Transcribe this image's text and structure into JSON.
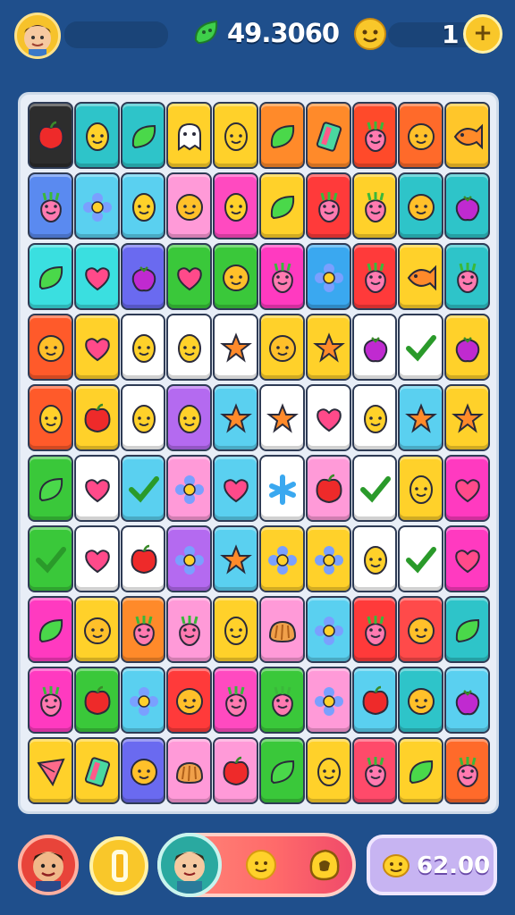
{
  "hud": {
    "score": "49.3060",
    "coins": "1",
    "plus_symbol": "+",
    "balance": "62.00"
  },
  "colors": {
    "background": "#1f4f8c",
    "board": "#e8eef7"
  },
  "icons": {
    "score_icon": "green-leaf-icon",
    "coin_icon": "gold-coin-face-icon",
    "balance_icon": "coin-face-icon"
  },
  "board": {
    "rows": [
      [
        [
          "#2d2d2d",
          "apple"
        ],
        [
          "#2ec4c9",
          "lemon"
        ],
        [
          "#2ec4c9",
          "leaf"
        ],
        [
          "#ffd12a",
          "ghost"
        ],
        [
          "#ffd12a",
          "lemon"
        ],
        [
          "#ff8a2a",
          "leaf"
        ],
        [
          "#ff8a2a",
          "candy"
        ],
        [
          "#ff4a2a",
          "radish"
        ],
        [
          "#ff6a2a",
          "face"
        ],
        [
          "#ffc62a",
          "fish"
        ]
      ],
      [
        [
          "#5a8af0",
          "radish"
        ],
        [
          "#5ad0f0",
          "flower"
        ],
        [
          "#5ad0f0",
          "lemon"
        ],
        [
          "#ff9ad8",
          "face"
        ],
        [
          "#ff4ac0",
          "lemon"
        ],
        [
          "#ffd12a",
          "leaf"
        ],
        [
          "#ff3a3a",
          "radish"
        ],
        [
          "#ffd12a",
          "radish"
        ],
        [
          "#2ec4c9",
          "face"
        ],
        [
          "#2ec4c9",
          "berry"
        ]
      ],
      [
        [
          "#3adfe0",
          "leaf"
        ],
        [
          "#3adfe0",
          "heart"
        ],
        [
          "#6a6af0",
          "berry"
        ],
        [
          "#3ac83a",
          "heart"
        ],
        [
          "#3ac83a",
          "face"
        ],
        [
          "#ff3ac0",
          "radish"
        ],
        [
          "#3aa8f0",
          "flower"
        ],
        [
          "#ff3a3a",
          "radish"
        ],
        [
          "#ffd12a",
          "fish"
        ],
        [
          "#2ec4c9",
          "radish"
        ]
      ],
      [
        [
          "#ff5a2a",
          "face"
        ],
        [
          "#ffd12a",
          "heart"
        ],
        [
          "#ffffff",
          "lemon"
        ],
        [
          "#ffffff",
          "lemon"
        ],
        [
          "#ffffff",
          "star"
        ],
        [
          "#ffd12a",
          "face"
        ],
        [
          "#ffd12a",
          "star"
        ],
        [
          "#ffffff",
          "berry"
        ],
        [
          "#ffffff",
          "check"
        ],
        [
          "#ffd12a",
          "berry"
        ]
      ],
      [
        [
          "#ff5a2a",
          "lemon"
        ],
        [
          "#ffd12a",
          "apple"
        ],
        [
          "#ffffff",
          "lemon"
        ],
        [
          "#b46af0",
          "lemon"
        ],
        [
          "#5ad0f0",
          "star"
        ],
        [
          "#ffffff",
          "star"
        ],
        [
          "#ffffff",
          "heart"
        ],
        [
          "#ffffff",
          "lemon"
        ],
        [
          "#5ad0f0",
          "star"
        ],
        [
          "#ffd12a",
          "star"
        ]
      ],
      [
        [
          "#3ac83a",
          "leaf"
        ],
        [
          "#ffffff",
          "heart"
        ],
        [
          "#5ad0f0",
          "check"
        ],
        [
          "#ff9ad8",
          "flower"
        ],
        [
          "#5ad0f0",
          "heart"
        ],
        [
          "#ffffff",
          "cross"
        ],
        [
          "#ff9ad8",
          "apple"
        ],
        [
          "#ffffff",
          "check"
        ],
        [
          "#ffd12a",
          "lemon"
        ],
        [
          "#ff3ac0",
          "heart"
        ]
      ],
      [
        [
          "#3ac83a",
          "check"
        ],
        [
          "#ffffff",
          "heart"
        ],
        [
          "#ffffff",
          "apple"
        ],
        [
          "#b46af0",
          "flower"
        ],
        [
          "#5ad0f0",
          "star"
        ],
        [
          "#ffd12a",
          "flower"
        ],
        [
          "#ffd12a",
          "flower"
        ],
        [
          "#ffffff",
          "lemon"
        ],
        [
          "#ffffff",
          "check"
        ],
        [
          "#ff3ac0",
          "heart"
        ]
      ],
      [
        [
          "#ff3ac0",
          "leaf"
        ],
        [
          "#ffd12a",
          "face"
        ],
        [
          "#ff8a2a",
          "radish"
        ],
        [
          "#ff9ad8",
          "radish"
        ],
        [
          "#ffd12a",
          "lemon"
        ],
        [
          "#ff9ad8",
          "bread"
        ],
        [
          "#5ad0f0",
          "flower"
        ],
        [
          "#ff3a3a",
          "radish"
        ],
        [
          "#ff4a4a",
          "face"
        ],
        [
          "#2ec4c9",
          "leaf"
        ]
      ],
      [
        [
          "#ff3ac0",
          "radish"
        ],
        [
          "#3ac83a",
          "apple"
        ],
        [
          "#5ad0f0",
          "flower"
        ],
        [
          "#ff3a3a",
          "face"
        ],
        [
          "#ff4ac0",
          "radish"
        ],
        [
          "#3ac83a",
          "radish"
        ],
        [
          "#ff9ad8",
          "flower"
        ],
        [
          "#5ad0f0",
          "apple"
        ],
        [
          "#2ec4c9",
          "face"
        ],
        [
          "#5ad0f0",
          "berry"
        ]
      ],
      [
        [
          "#ffd12a",
          "kite"
        ],
        [
          "#ffd12a",
          "candy"
        ],
        [
          "#6a6af0",
          "face"
        ],
        [
          "#ff9ad8",
          "bread"
        ],
        [
          "#ff9ad8",
          "apple"
        ],
        [
          "#3ac83a",
          "leaf"
        ],
        [
          "#ffd12a",
          "lemon"
        ],
        [
          "#ff4a6a",
          "radish"
        ],
        [
          "#ffd12a",
          "leaf"
        ],
        [
          "#ff6a2a",
          "radish"
        ]
      ]
    ]
  }
}
